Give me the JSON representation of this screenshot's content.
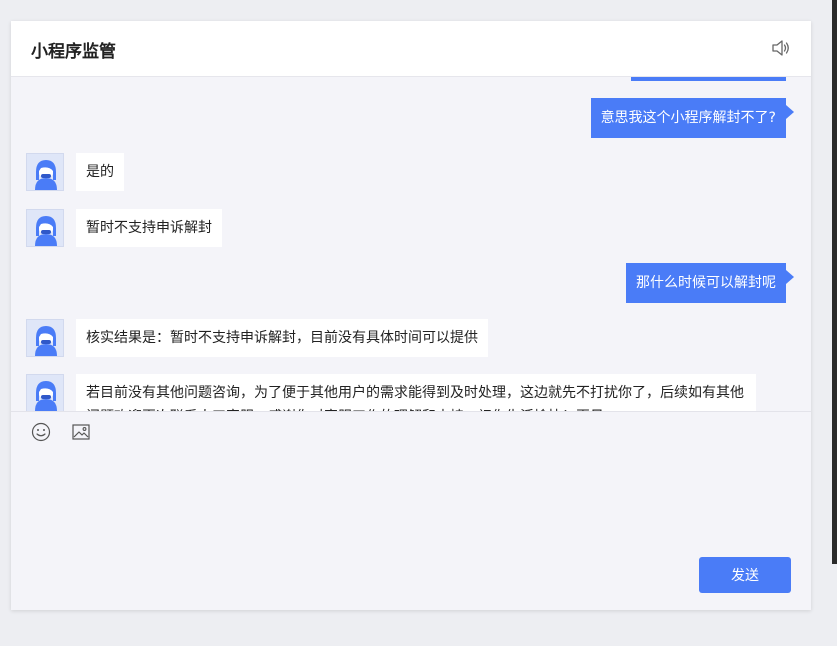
{
  "header": {
    "title": "小程序监管",
    "sound_icon": "speaker-icon"
  },
  "messages": [
    {
      "side": "out",
      "text": "意思我这个小程序解封不了?"
    },
    {
      "side": "in",
      "text": "是的"
    },
    {
      "side": "in",
      "text": "暂时不支持申诉解封"
    },
    {
      "side": "out",
      "text": "那什么时候可以解封呢"
    },
    {
      "side": "in",
      "text": "核实结果是：暂时不支持申诉解封，目前没有具体时间可以提供"
    },
    {
      "side": "in",
      "text": "若目前没有其他问题咨询，为了便于其他用户的需求能得到及时处理，这边就先不打扰你了，后续如有其他问题欢迎再次联系人工客服，感谢你对客服工作的理解和支持，祝你生活愉快！再见"
    }
  ],
  "composer": {
    "emoji_icon": "emoji-icon",
    "image_icon": "image-icon",
    "send_label": "发送"
  },
  "colors": {
    "accent": "#4a7cf7",
    "page_bg": "#edeef2",
    "panel_bg": "#f4f4f9"
  }
}
